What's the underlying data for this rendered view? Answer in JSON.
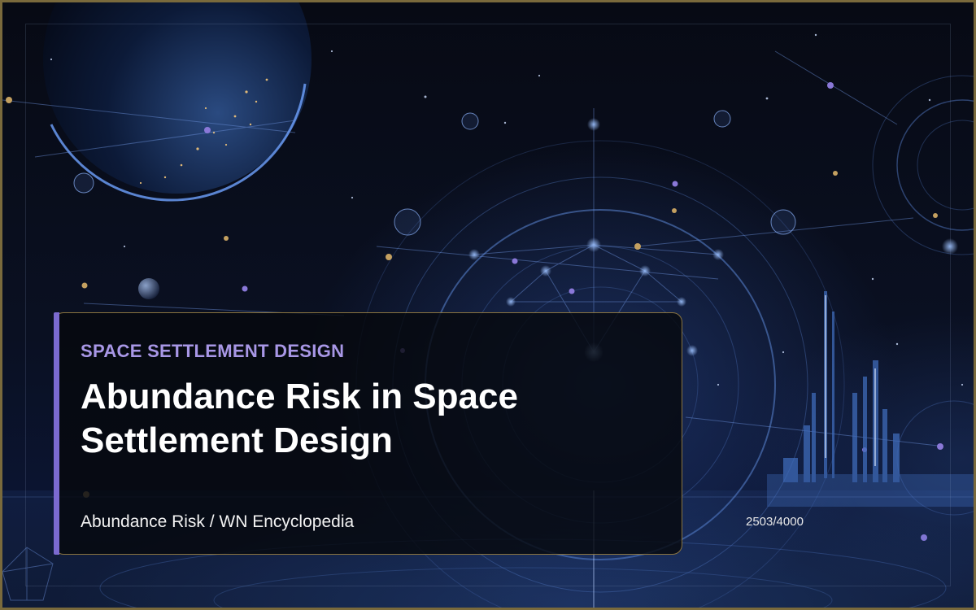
{
  "card": {
    "category": "SPACE SETTLEMENT DESIGN",
    "title": "Abundance Risk in Space Settlement Design",
    "source": "Abundance Risk / WN Encyclopedia"
  },
  "counter": "2503/4000",
  "colors": {
    "frame_border": "#7a6a3c",
    "card_border": "#8a7440",
    "accent_bar": "#7b6ad0",
    "category_text": "#a897e6",
    "title_text": "#ffffff",
    "background": "#05070f"
  },
  "background_image": "space-settlement-illustration"
}
